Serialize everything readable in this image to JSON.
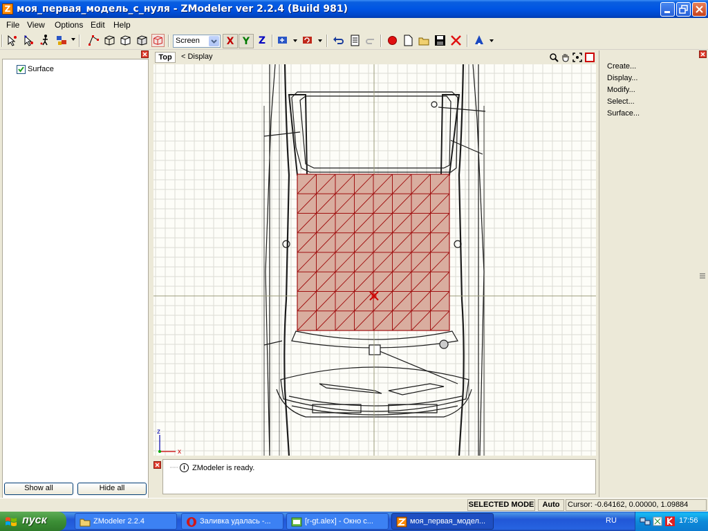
{
  "window": {
    "title": "моя_первая_модель_с_нуля - ZModeler ver 2.2.4 (Build 981)",
    "app_icon_letter": "Z"
  },
  "menu": [
    "File",
    "View",
    "Options",
    "Edit",
    "Help"
  ],
  "toolbar": {
    "coord_mode": "Screen",
    "axis_x": "X",
    "axis_y": "Y",
    "axis_z": "Z"
  },
  "left_panel": {
    "tree_item": "Surface",
    "show_all": "Show all",
    "hide_all": "Hide all"
  },
  "viewport": {
    "view_name": "Top",
    "display_menu": "< Display",
    "axis_gizmo_z": "z",
    "axis_gizmo_x": "x"
  },
  "log": {
    "message": "ZModeler is ready.",
    "icon_letter": "i"
  },
  "commands": [
    "Create...",
    "Display...",
    "Modify...",
    "Select...",
    "Surface..."
  ],
  "status": {
    "mode": "SELECTED MODE",
    "auto": "Auto",
    "cursor": "Cursor: -0.64162, 0.00000, 1.09884"
  },
  "taskbar": {
    "start": "пуск",
    "tasks": [
      "ZModeler 2.2.4",
      "Заливка удалась -...",
      "[r-gt.alex] - Окно с...",
      "моя_первая_модел..."
    ],
    "language": "RU",
    "clock": "17:56"
  },
  "colors": {
    "surface_fill": "#d9ad9f",
    "surface_edge": "#a01010",
    "grid": "#dcdcd4",
    "title_bar": "#0054e3"
  }
}
